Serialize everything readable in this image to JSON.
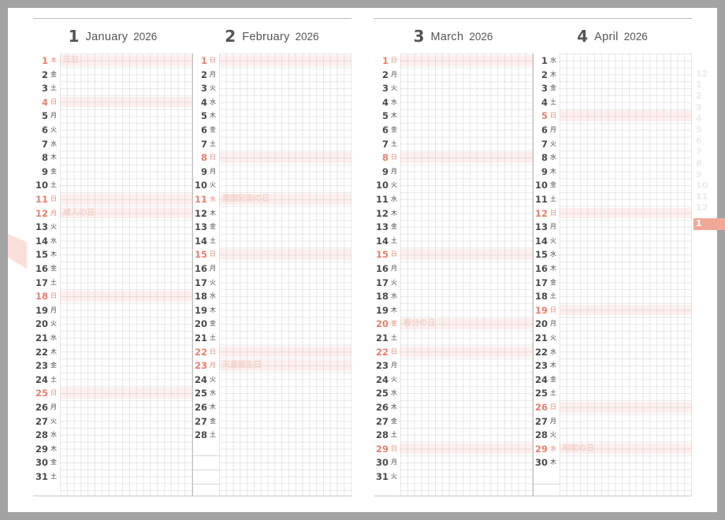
{
  "colors": {
    "accent": "#e9806e",
    "holiday_fill": "#fbe7e3",
    "index_active": "#f2a898",
    "frame": "#a3a3a3"
  },
  "months": [
    {
      "num": "1",
      "name": "January",
      "year": "2026",
      "empty_rows": 0,
      "days": [
        {
          "d": "1",
          "w": "木",
          "hol": true,
          "name": "元日"
        },
        {
          "d": "2",
          "w": "金"
        },
        {
          "d": "3",
          "w": "土"
        },
        {
          "d": "4",
          "w": "日",
          "hol": true
        },
        {
          "d": "5",
          "w": "月"
        },
        {
          "d": "6",
          "w": "火"
        },
        {
          "d": "7",
          "w": "水"
        },
        {
          "d": "8",
          "w": "木"
        },
        {
          "d": "9",
          "w": "金"
        },
        {
          "d": "10",
          "w": "土"
        },
        {
          "d": "11",
          "w": "日",
          "hol": true
        },
        {
          "d": "12",
          "w": "月",
          "hol": true,
          "name": "成人の日"
        },
        {
          "d": "13",
          "w": "火"
        },
        {
          "d": "14",
          "w": "水"
        },
        {
          "d": "15",
          "w": "木"
        },
        {
          "d": "16",
          "w": "金"
        },
        {
          "d": "17",
          "w": "土"
        },
        {
          "d": "18",
          "w": "日",
          "hol": true
        },
        {
          "d": "19",
          "w": "月"
        },
        {
          "d": "20",
          "w": "火"
        },
        {
          "d": "21",
          "w": "水"
        },
        {
          "d": "22",
          "w": "木"
        },
        {
          "d": "23",
          "w": "金"
        },
        {
          "d": "24",
          "w": "土"
        },
        {
          "d": "25",
          "w": "日",
          "hol": true
        },
        {
          "d": "26",
          "w": "月"
        },
        {
          "d": "27",
          "w": "火"
        },
        {
          "d": "28",
          "w": "水"
        },
        {
          "d": "29",
          "w": "木"
        },
        {
          "d": "30",
          "w": "金"
        },
        {
          "d": "31",
          "w": "土"
        }
      ]
    },
    {
      "num": "2",
      "name": "February",
      "year": "2026",
      "empty_rows": 3,
      "days": [
        {
          "d": "1",
          "w": "日",
          "hol": true
        },
        {
          "d": "2",
          "w": "月"
        },
        {
          "d": "3",
          "w": "火"
        },
        {
          "d": "4",
          "w": "水"
        },
        {
          "d": "5",
          "w": "木"
        },
        {
          "d": "6",
          "w": "金"
        },
        {
          "d": "7",
          "w": "土"
        },
        {
          "d": "8",
          "w": "日",
          "hol": true
        },
        {
          "d": "9",
          "w": "月"
        },
        {
          "d": "10",
          "w": "火"
        },
        {
          "d": "11",
          "w": "水",
          "hol": true,
          "name": "建国記念の日"
        },
        {
          "d": "12",
          "w": "木"
        },
        {
          "d": "13",
          "w": "金"
        },
        {
          "d": "14",
          "w": "土"
        },
        {
          "d": "15",
          "w": "日",
          "hol": true
        },
        {
          "d": "16",
          "w": "月"
        },
        {
          "d": "17",
          "w": "火"
        },
        {
          "d": "18",
          "w": "水"
        },
        {
          "d": "19",
          "w": "木"
        },
        {
          "d": "20",
          "w": "金"
        },
        {
          "d": "21",
          "w": "土"
        },
        {
          "d": "22",
          "w": "日",
          "hol": true
        },
        {
          "d": "23",
          "w": "月",
          "hol": true,
          "name": "天皇誕生日"
        },
        {
          "d": "24",
          "w": "火"
        },
        {
          "d": "25",
          "w": "水"
        },
        {
          "d": "26",
          "w": "木"
        },
        {
          "d": "27",
          "w": "金"
        },
        {
          "d": "28",
          "w": "土"
        }
      ]
    },
    {
      "num": "3",
      "name": "March",
      "year": "2026",
      "empty_rows": 0,
      "days": [
        {
          "d": "1",
          "w": "日",
          "hol": true
        },
        {
          "d": "2",
          "w": "月"
        },
        {
          "d": "3",
          "w": "火"
        },
        {
          "d": "4",
          "w": "水"
        },
        {
          "d": "5",
          "w": "木"
        },
        {
          "d": "6",
          "w": "金"
        },
        {
          "d": "7",
          "w": "土"
        },
        {
          "d": "8",
          "w": "日",
          "hol": true
        },
        {
          "d": "9",
          "w": "月"
        },
        {
          "d": "10",
          "w": "火"
        },
        {
          "d": "11",
          "w": "水"
        },
        {
          "d": "12",
          "w": "木"
        },
        {
          "d": "13",
          "w": "金"
        },
        {
          "d": "14",
          "w": "土"
        },
        {
          "d": "15",
          "w": "日",
          "hol": true
        },
        {
          "d": "16",
          "w": "月"
        },
        {
          "d": "17",
          "w": "火"
        },
        {
          "d": "18",
          "w": "水"
        },
        {
          "d": "19",
          "w": "木"
        },
        {
          "d": "20",
          "w": "金",
          "hol": true,
          "name": "春分の日"
        },
        {
          "d": "21",
          "w": "土"
        },
        {
          "d": "22",
          "w": "日",
          "hol": true
        },
        {
          "d": "23",
          "w": "月"
        },
        {
          "d": "24",
          "w": "火"
        },
        {
          "d": "25",
          "w": "水"
        },
        {
          "d": "26",
          "w": "木"
        },
        {
          "d": "27",
          "w": "金"
        },
        {
          "d": "28",
          "w": "土"
        },
        {
          "d": "29",
          "w": "日",
          "hol": true
        },
        {
          "d": "30",
          "w": "月"
        },
        {
          "d": "31",
          "w": "火"
        }
      ]
    },
    {
      "num": "4",
      "name": "April",
      "year": "2026",
      "empty_rows": 1,
      "days": [
        {
          "d": "1",
          "w": "水"
        },
        {
          "d": "2",
          "w": "木"
        },
        {
          "d": "3",
          "w": "金"
        },
        {
          "d": "4",
          "w": "土"
        },
        {
          "d": "5",
          "w": "日",
          "hol": true
        },
        {
          "d": "6",
          "w": "月"
        },
        {
          "d": "7",
          "w": "火"
        },
        {
          "d": "8",
          "w": "水"
        },
        {
          "d": "9",
          "w": "木"
        },
        {
          "d": "10",
          "w": "金"
        },
        {
          "d": "11",
          "w": "土"
        },
        {
          "d": "12",
          "w": "日",
          "hol": true
        },
        {
          "d": "13",
          "w": "月"
        },
        {
          "d": "14",
          "w": "火"
        },
        {
          "d": "15",
          "w": "水"
        },
        {
          "d": "16",
          "w": "木"
        },
        {
          "d": "17",
          "w": "金"
        },
        {
          "d": "18",
          "w": "土"
        },
        {
          "d": "19",
          "w": "日",
          "hol": true
        },
        {
          "d": "20",
          "w": "月"
        },
        {
          "d": "21",
          "w": "火"
        },
        {
          "d": "22",
          "w": "水"
        },
        {
          "d": "23",
          "w": "木"
        },
        {
          "d": "24",
          "w": "金"
        },
        {
          "d": "25",
          "w": "土"
        },
        {
          "d": "26",
          "w": "日",
          "hol": true
        },
        {
          "d": "27",
          "w": "月"
        },
        {
          "d": "28",
          "w": "火"
        },
        {
          "d": "29",
          "w": "水",
          "hol": true,
          "name": "昭和の日"
        },
        {
          "d": "30",
          "w": "木"
        }
      ]
    }
  ],
  "month_index": [
    "12",
    "1",
    "2",
    "3",
    "4",
    "5",
    "6",
    "7",
    "8",
    "9",
    "10",
    "11",
    "12",
    "1"
  ],
  "month_index_active": 13
}
